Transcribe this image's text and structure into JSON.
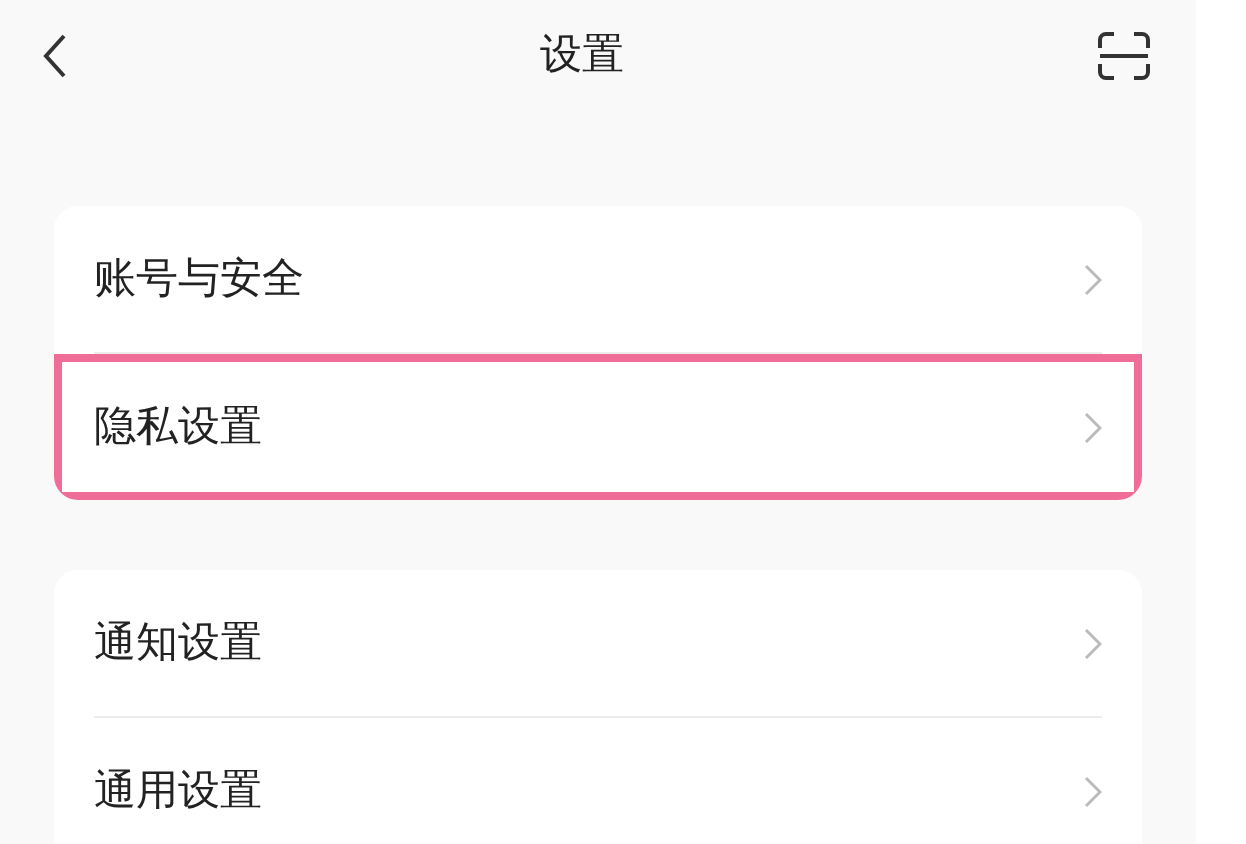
{
  "header": {
    "title": "设置"
  },
  "groups": [
    {
      "items": [
        {
          "label": "账号与安全",
          "highlighted": false
        },
        {
          "label": "隐私设置",
          "highlighted": true
        }
      ]
    },
    {
      "items": [
        {
          "label": "通知设置",
          "highlighted": false
        },
        {
          "label": "通用设置",
          "highlighted": false
        }
      ]
    }
  ]
}
